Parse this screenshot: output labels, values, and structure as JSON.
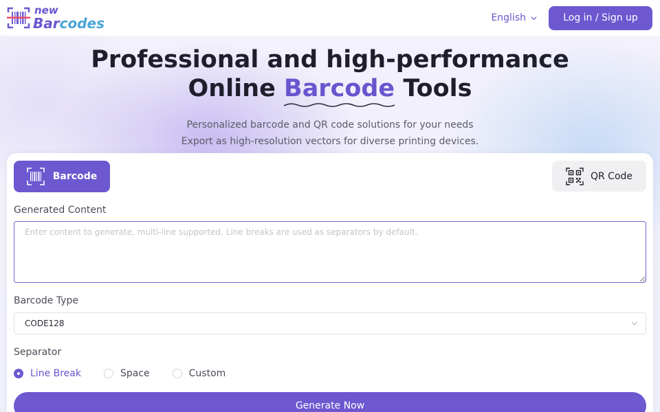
{
  "brand": {
    "logo_line1": "new",
    "logo_line2_a": "Bar",
    "logo_line2_b": "codes"
  },
  "header": {
    "language": "English",
    "login_label": "Log in / Sign up"
  },
  "hero": {
    "title_line1": "Professional and high-performance",
    "title_line2_prefix": "Online ",
    "title_line2_highlight": "Barcode",
    "title_line2_suffix": " Tools",
    "subtitle_line1": "Personalized barcode and QR code solutions for your needs",
    "subtitle_line2": "Export as high-resolution vectors for diverse printing devices."
  },
  "tabs": {
    "barcode_label": "Barcode",
    "qr_label": "QR Code",
    "active": "barcode"
  },
  "form": {
    "content_label": "Generated Content",
    "content_placeholder": "Enter content to generate, multi-line supported. Line breaks are used as separators by default.",
    "content_value": "",
    "type_label": "Barcode Type",
    "type_value": "CODE128",
    "separator_label": "Separator",
    "separator_options": [
      "Line Break",
      "Space",
      "Custom"
    ],
    "separator_selected": "Line Break",
    "generate_label": "Generate Now"
  },
  "colors": {
    "accent": "#6d58d0",
    "accent_text": "#6a55cf",
    "logo_accent": "#4aa6d6"
  },
  "icons": {
    "logo": "barcode-logo-icon",
    "language": "chevron-down-icon",
    "barcode_tab": "barcode-icon",
    "qr_tab": "qr-code-icon",
    "select": "chevron-down-icon"
  }
}
